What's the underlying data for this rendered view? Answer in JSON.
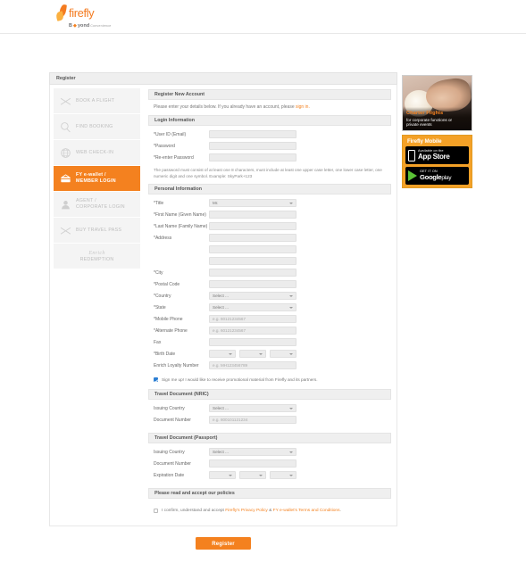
{
  "brand": {
    "name": "firefly",
    "tagline_bold": "B",
    "tagline_mid": "yond",
    "tagline_light": "Convenience",
    "accent": "#f4811f"
  },
  "breadcrumb": {
    "label": "Register"
  },
  "sidebar": {
    "items": [
      {
        "label": "BOOK A FLIGHT",
        "icon": "plane-icon",
        "active": false
      },
      {
        "label": "FIND BOOKING",
        "icon": "magnifier-icon",
        "active": false
      },
      {
        "label": "WEB CHECK-IN",
        "icon": "globe-icon",
        "active": false
      },
      {
        "label_line1": "FY e-wallet /",
        "label_line2": "MEMBER LOGIN",
        "icon": "wallet-icon",
        "active": true
      },
      {
        "label_line1": "AGENT /",
        "label_line2": "CORPORATE LOGIN",
        "icon": "user-icon",
        "active": false
      },
      {
        "label": "BUY TRAVEL PASS",
        "icon": "plane-icon",
        "active": false
      },
      {
        "script": "Enrich",
        "label": "REDEMPTION",
        "icon": "enrich-icon",
        "active": false
      }
    ]
  },
  "main": {
    "title": "Register New Account",
    "intro_before": "Please enter your details below. If you already have an account, please ",
    "intro_link": "sign in.",
    "login_section": "Login Information",
    "fields_login": [
      {
        "label": "*User ID (Email)",
        "value": "",
        "placeholder": ""
      },
      {
        "label": "*Password",
        "value": "",
        "placeholder": ""
      },
      {
        "label": "*Re-enter Password",
        "value": "",
        "placeholder": ""
      }
    ],
    "password_hint": "The password must consist of at least one 8 characters, must include at least one upper case letter, one lower case letter, one numeric digit and one symbol. Example: SkyPark+123",
    "personal_section": "Personal Information",
    "title_label": "*Title",
    "title_value": "Mr.",
    "fields_personal": [
      {
        "label": "*First Name (Given Name)",
        "value": "",
        "placeholder": ""
      },
      {
        "label": "*Last Name (Family Name)",
        "value": "",
        "placeholder": ""
      },
      {
        "label": "*Address",
        "value": "",
        "placeholder": ""
      },
      {
        "label": "",
        "value": "",
        "placeholder": ""
      },
      {
        "label": "",
        "value": "",
        "placeholder": ""
      },
      {
        "label": "*City",
        "value": "",
        "placeholder": ""
      },
      {
        "label": "*Postal Code",
        "value": "",
        "placeholder": ""
      }
    ],
    "country_label": "*Country",
    "country_value": "Select ...",
    "state_label": "*State",
    "state_value": "Select ...",
    "mobile_label": "*Mobile Phone",
    "mobile_placeholder": "e.g. 60121234567",
    "alternate_label": "*Alternate Phone",
    "alternate_placeholder": "e.g. 60121234567",
    "fax_label": "Fax",
    "fax_value": "",
    "birth_label": "*Birth Date",
    "birth_day": "",
    "birth_month": "",
    "birth_year": "",
    "enrich_label": "Enrich Loyalty Number",
    "enrich_placeholder": "e.g. MH123456789",
    "signup_checkbox_checked": true,
    "signup_text": "Sign me up! I would like to receive promotional material from Firefly and its partners.",
    "nric_section": "Travel Document (NRIC)",
    "nric_country_label": "Issuing Country",
    "nric_country_value": "Select ...",
    "nric_doc_label": "Document Number",
    "nric_doc_placeholder": "e.g. 800101121234",
    "passport_section": "Travel Document (Passport)",
    "passport_country_label": "Issuing Country",
    "passport_country_value": "Select ...",
    "passport_doc_label": "Document Number",
    "passport_doc_value": "",
    "passport_exp_label": "Expiration Date",
    "passport_exp_day": "",
    "passport_exp_month": "",
    "passport_exp_year": "",
    "policy_section": "Please read and accept our policies",
    "policy_checked": false,
    "policy_text_1": "I confirm, understand and accept ",
    "policy_link_1": "Firefly's Privacy Policy",
    "policy_text_2": " & ",
    "policy_link_2": "FY e-wallet's Terms and Conditions",
    "policy_text_3": ".",
    "submit_label": "Register"
  },
  "rail": {
    "promo_title": "Charter Flights",
    "promo_sub_line1": "for corporate functions or",
    "promo_sub_line2": "private events",
    "app_title": "Firefly Mobile",
    "appstore_small": "Available on the",
    "appstore_big": "App Store",
    "google_small": "GET IT ON",
    "google_big": "Google",
    "google_big2": "play"
  }
}
